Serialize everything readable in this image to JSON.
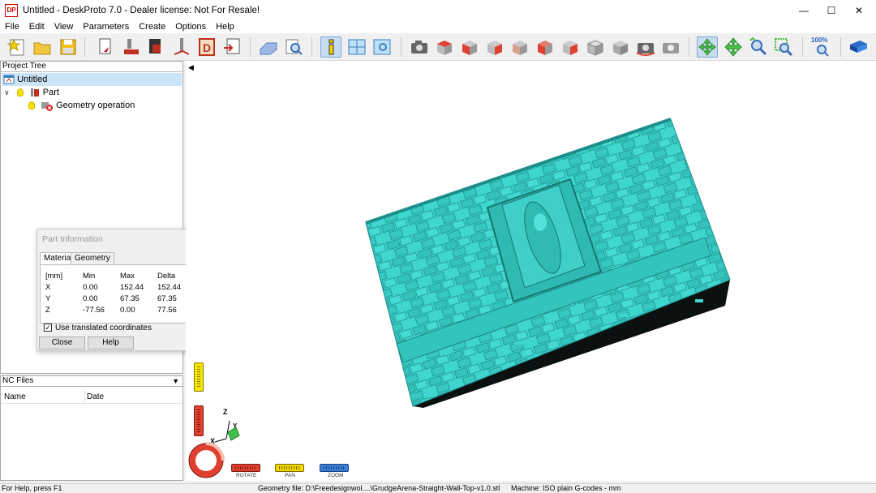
{
  "window": {
    "title": "Untitled - DeskProto 7.0 - Dealer license: Not For Resale!",
    "logo_text": "DP"
  },
  "menu": [
    "File",
    "Edit",
    "View",
    "Parameters",
    "Create",
    "Options",
    "Help"
  ],
  "project_tree": {
    "header": "Project Tree",
    "items": [
      {
        "label": "Untitled"
      },
      {
        "label": "Part"
      },
      {
        "label": "Geometry operation"
      }
    ]
  },
  "nc_files": {
    "header": "NC Files",
    "columns": [
      "Name",
      "Date"
    ]
  },
  "part_information": {
    "title": "Part Information",
    "tabs": [
      "Material",
      "Geometry"
    ],
    "headers": [
      "[mm]",
      "Min",
      "Max",
      "Delta"
    ],
    "rows": [
      [
        "X",
        "0.00",
        "152.44",
        "152.44"
      ],
      [
        "Y",
        "0.00",
        "67.35",
        "67.35"
      ],
      [
        "Z",
        "-77.56",
        "0.00",
        "77.56"
      ]
    ],
    "checkbox_label": "Use translated coordinates",
    "checkbox_checked": true,
    "close_label": "Close",
    "help_label": "Help"
  },
  "toolbar": {
    "zoom_label": "100%"
  },
  "manipulators": {
    "rotate_label": "ROTATE",
    "pan_label": "PAN",
    "zoom_label": "ZOOM",
    "axis_z": "Z",
    "axis_x": "X",
    "axis_y": "Y"
  },
  "statusbar": {
    "help": "For Help, press F1",
    "geometry": "Geometry file: D:\\Freedesignwol....\\GrudgeArena-Straight-Wall-Top-v1.0.stl",
    "machine": "Machine: ISO plain G-codes - mm"
  },
  "colors": {
    "model": "#3ccfc9",
    "model_side": "#000000",
    "selection": "#cce4f7",
    "rotate": "#e0402a",
    "pan": "#e8d000",
    "zoom": "#3a7fd8"
  }
}
